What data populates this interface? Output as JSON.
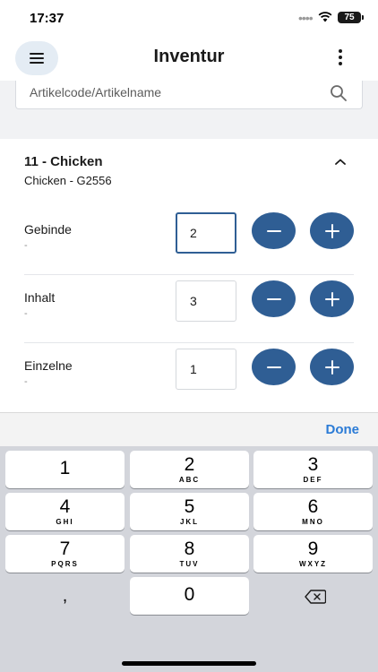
{
  "status_bar": {
    "time": "17:37",
    "battery": "75"
  },
  "app_bar": {
    "title": "Inventur"
  },
  "search": {
    "placeholder": "Artikelcode/Artikelname"
  },
  "article": {
    "title": "11 - Chicken",
    "subtitle": "Chicken - G2556",
    "rows": [
      {
        "label": "Gebinde",
        "sub": "-",
        "value": "2",
        "focused": true
      },
      {
        "label": "Inhalt",
        "sub": "-",
        "value": "3",
        "focused": false
      },
      {
        "label": "Einzelne",
        "sub": "-",
        "value": "1",
        "focused": false
      }
    ]
  },
  "accessory": {
    "done_label": "Done"
  },
  "keyboard": {
    "keys": [
      {
        "num": "1",
        "letters": ""
      },
      {
        "num": "2",
        "letters": "ABC"
      },
      {
        "num": "3",
        "letters": "DEF"
      },
      {
        "num": "4",
        "letters": "GHI"
      },
      {
        "num": "5",
        "letters": "JKL"
      },
      {
        "num": "6",
        "letters": "MNO"
      },
      {
        "num": "7",
        "letters": "PQRS"
      },
      {
        "num": "8",
        "letters": "TUV"
      },
      {
        "num": "9",
        "letters": "WXYZ"
      },
      {
        "num": "0",
        "letters": ""
      }
    ],
    "comma_label": ","
  },
  "colors": {
    "primary": "#2f5e94",
    "done": "#2b7bd6",
    "keyboard_bg": "#d3d5db"
  },
  "icons": [
    "hamburger-icon",
    "more-vertical-icon",
    "search-icon",
    "chevron-up-icon",
    "minus-icon",
    "plus-icon",
    "backspace-icon",
    "wifi-icon"
  ]
}
